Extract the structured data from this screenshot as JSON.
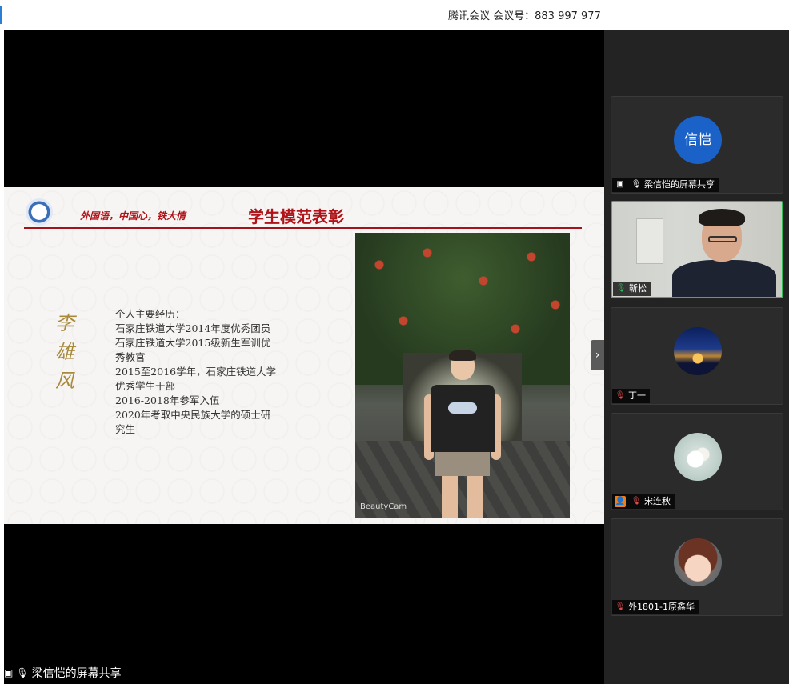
{
  "window": {
    "meeting_info": "腾讯会议 会议号：883 997 977"
  },
  "slide": {
    "slogan": "外国语，中国心，铁大情",
    "title": "学生模范表彰",
    "name_vertical": "李雄风",
    "bio_lines": [
      "个人主要经历：",
      "石家庄铁道大学2014年度优秀团员",
      "石家庄铁道大学2015级新生军训优",
      "秀教官",
      "2015至2016学年，石家庄铁道大学",
      "优秀学生干部",
      "2016-2018年参军入伍",
      "2020年考取中央民族大学的硕士研",
      "究生"
    ],
    "photo_watermark": "BeautyCam"
  },
  "participants": [
    {
      "name": "梁信恺的屏幕共享",
      "avatar_text": "信恺",
      "status_icon": "screen-share-icon",
      "mic": "on"
    },
    {
      "name": "靳松",
      "status_icon": "none",
      "mic": "on",
      "video": true
    },
    {
      "name": "丁一",
      "status_icon": "none",
      "mic": "muted"
    },
    {
      "name": "宋连秋",
      "status_icon": "person-icon",
      "mic": "muted"
    },
    {
      "name": "外1801-1原鑫华",
      "status_icon": "none",
      "mic": "muted"
    }
  ],
  "share_label": "梁信恺的屏幕共享",
  "colors": {
    "accent_green": "#2fbb5a",
    "slide_red": "#b0141a",
    "avatar_blue": "#1a62c8"
  }
}
